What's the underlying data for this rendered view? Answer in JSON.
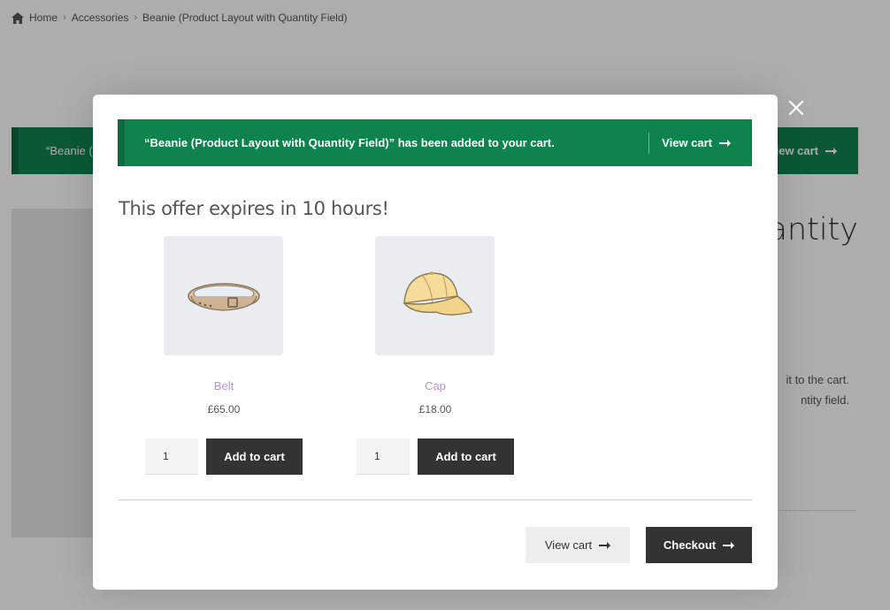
{
  "background": {
    "breadcrumb": {
      "home": "Home",
      "category": "Accessories",
      "current": "Beanie (Product Layout with Quantity Field)"
    },
    "notice_text": "“Beanie (P",
    "notice_view_cart": "iew cart",
    "title_fragment": "uantity",
    "desc_line1": "it to the cart.",
    "desc_line2": "ntity field."
  },
  "modal": {
    "notice": {
      "message": "“Beanie (Product Layout with Quantity Field)” has been added to your cart.",
      "view_cart": "View cart"
    },
    "offer_heading": "This offer expires in 10 hours!",
    "products": [
      {
        "name": "Belt",
        "price": "£65.00",
        "qty": "1",
        "add_label": "Add to cart",
        "image_icon": "belt-icon"
      },
      {
        "name": "Cap",
        "price": "£18.00",
        "qty": "1",
        "add_label": "Add to cart",
        "image_icon": "cap-icon"
      }
    ],
    "footer": {
      "view_cart": "View cart",
      "checkout": "Checkout"
    }
  },
  "colors": {
    "notice_green": "#0f834d",
    "dark_button": "#333333",
    "product_link": "#b695c9"
  }
}
